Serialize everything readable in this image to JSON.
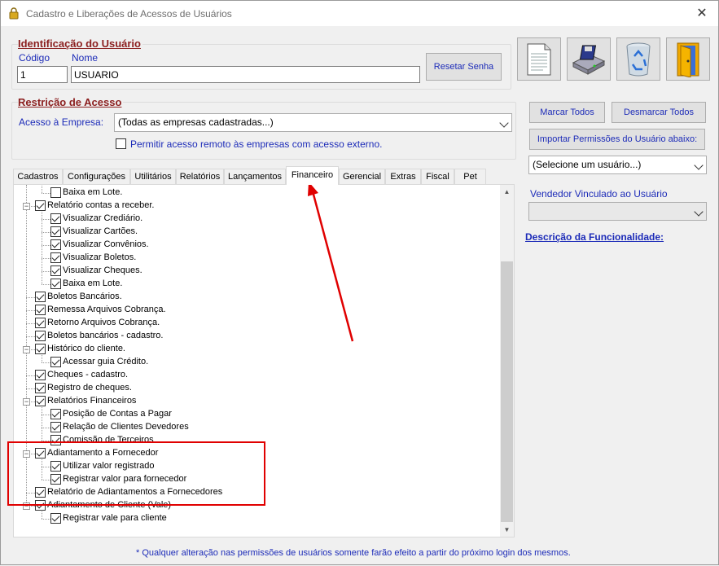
{
  "window": {
    "title": "Cadastro e Liberações de Acessos de Usuários",
    "close_symbol": "✕"
  },
  "identificacao": {
    "group_label": "Identificação do Usuário",
    "codigo_label": "Código",
    "codigo_value": "1",
    "nome_label": "Nome",
    "nome_value": "USUARIO",
    "reset_button": "Resetar Senha"
  },
  "toolbar": {
    "icons": [
      "new-document-icon",
      "save-disk-icon",
      "recycle-bin-icon",
      "exit-door-icon"
    ]
  },
  "restricao": {
    "group_label": "Restrição de Acesso",
    "acesso_label": "Acesso à Empresa:",
    "acesso_value": "(Todas as empresas cadastradas...)",
    "remoto_label": "Permitir acesso remoto às empresas com acesso externo."
  },
  "right_panel": {
    "marcar_todos": "Marcar Todos",
    "desmarcar_todos": "Desmarcar Todos",
    "importar": "Importar Permissões do Usuário abaixo:",
    "usuario_select": "(Selecione um usuário...)",
    "vendedor_label": "Vendedor Vinculado ao Usuário",
    "vendedor_value": "",
    "descricao_label": "Descrição da Funcionalidade:"
  },
  "tabs": [
    "Cadastros",
    "Configurações",
    "Utilitários",
    "Relatórios",
    "Lançamentos",
    "Financeiro",
    "Gerencial",
    "Extras",
    "Fiscal",
    "Pet"
  ],
  "active_tab": "Financeiro",
  "tree": [
    {
      "label": "Baixa em Lote.",
      "level": 2,
      "checked": false
    },
    {
      "label": "Relatório contas a receber.",
      "level": 1,
      "checked": true,
      "expander": "−"
    },
    {
      "label": "Visualizar Crediário.",
      "level": 2,
      "checked": true
    },
    {
      "label": "Visualizar Cartões.",
      "level": 2,
      "checked": true
    },
    {
      "label": "Visualizar Convênios.",
      "level": 2,
      "checked": true
    },
    {
      "label": "Visualizar Boletos.",
      "level": 2,
      "checked": true
    },
    {
      "label": "Visualizar Cheques.",
      "level": 2,
      "checked": true
    },
    {
      "label": "Baixa em Lote.",
      "level": 2,
      "checked": true
    },
    {
      "label": "Boletos Bancários.",
      "level": 1,
      "checked": true
    },
    {
      "label": "Remessa Arquivos Cobrança.",
      "level": 1,
      "checked": true
    },
    {
      "label": "Retorno Arquivos Cobrança.",
      "level": 1,
      "checked": true
    },
    {
      "label": "Boletos bancários - cadastro.",
      "level": 1,
      "checked": true
    },
    {
      "label": "Histórico do cliente.",
      "level": 1,
      "checked": true,
      "expander": "−"
    },
    {
      "label": "Acessar guia Crédito.",
      "level": 2,
      "checked": true
    },
    {
      "label": "Cheques - cadastro.",
      "level": 1,
      "checked": true
    },
    {
      "label": "Registro de cheques.",
      "level": 1,
      "checked": true
    },
    {
      "label": "Relatórios Financeiros",
      "level": 1,
      "checked": true,
      "expander": "−"
    },
    {
      "label": "Posição de Contas a Pagar",
      "level": 2,
      "checked": true
    },
    {
      "label": "Relação de Clientes Devedores",
      "level": 2,
      "checked": true
    },
    {
      "label": "Comissão de Terceiros",
      "level": 2,
      "checked": true
    },
    {
      "label": "Adiantamento a Fornecedor",
      "level": 1,
      "checked": true,
      "expander": "−"
    },
    {
      "label": "Utilizar valor registrado",
      "level": 2,
      "checked": true
    },
    {
      "label": "Registrar valor para fornecedor",
      "level": 2,
      "checked": true
    },
    {
      "label": "Relatório de Adiantamentos a Fornecedores",
      "level": 1,
      "checked": true
    },
    {
      "label": "Adiantamento de Cliente (Vale)",
      "level": 1,
      "checked": true,
      "expander": "−"
    },
    {
      "label": "Registrar vale para cliente",
      "level": 2,
      "checked": true
    }
  ],
  "footnote": "* Qualquer alteração nas permissões de usuários somente farão efeito a partir do próximo login dos mesmos.",
  "annotations": {
    "highlight_color": "#e00000",
    "arrow_color": "#e00000"
  }
}
